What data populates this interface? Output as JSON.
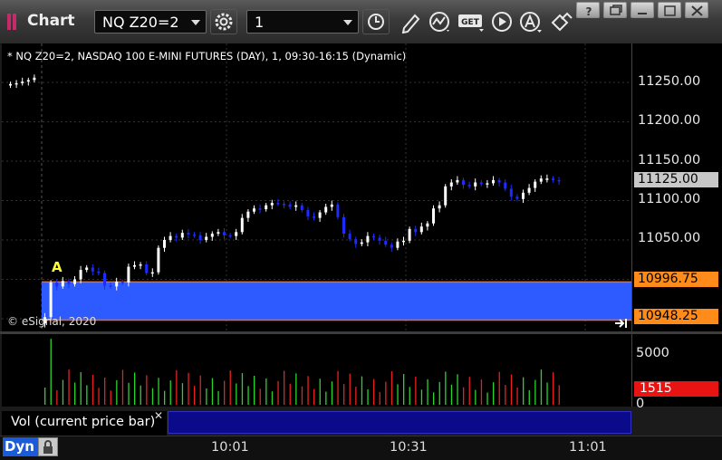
{
  "app": {
    "title": "Chart"
  },
  "toolbar": {
    "symbol_value": "NQ Z20=2",
    "interval_value": "1",
    "icons": [
      "settings-gear-icon",
      "clock-icon",
      "pencil-draw-icon",
      "study-wave-icon",
      "get-icon",
      "play-icon",
      "cursor-a-icon",
      "link-icon"
    ],
    "get_label": "GET"
  },
  "window": {
    "buttons": [
      "help-icon",
      "restore-icon",
      "maximize-icon",
      "close-icon"
    ],
    "help_label": "?"
  },
  "chart": {
    "header": "* NQ Z20=2, NASDAQ 100 E-MINI FUTURES (DAY), 1, 09:30-16:15 (Dynamic)",
    "copyright": "© eSignal, 2020",
    "price_axis_labels": [
      "11250.00",
      "11200.00",
      "11150.00",
      "11100.00",
      "11050.00"
    ],
    "last_price": "11125.00",
    "upper_level": "10996.75",
    "lower_level": "10948.25",
    "marker": "A",
    "colors": {
      "up": "#ffffff",
      "down": "#1d2bff",
      "range_fill": "#2d5bff",
      "range_line": "#ff6a00",
      "tag": "#ff8c1a"
    }
  },
  "chart_data": {
    "type": "candlestick",
    "title": "NQ Z20=2, NASDAQ 100 E-MINI FUTURES (DAY), 1, 09:30-16:15 (Dynamic)",
    "ylim": [
      10940,
      11280
    ],
    "x_ticks": [
      "10:01",
      "10:31",
      "11:01"
    ],
    "closes": [
      11248,
      11249,
      11251,
      11253,
      11256,
      10952,
      10996,
      10991,
      10998,
      10994,
      11000,
      11012,
      11015,
      11010,
      11008,
      10992,
      10991,
      10997,
      10996,
      11016,
      11018,
      11019,
      11008,
      11009,
      11040,
      11050,
      11055,
      11053,
      11059,
      11057,
      11056,
      11050,
      11054,
      11058,
      11060,
      11056,
      11055,
      11060,
      11078,
      11086,
      11090,
      11089,
      11094,
      11097,
      11096,
      11095,
      11092,
      11094,
      11088,
      11080,
      11078,
      11085,
      11092,
      11095,
      11079,
      11058,
      11051,
      11045,
      11047,
      11055,
      11053,
      11049,
      11044,
      11040,
      11048,
      11049,
      11064,
      11060,
      11067,
      11071,
      11090,
      11094,
      11118,
      11123,
      11126,
      11120,
      11118,
      11123,
      11121,
      11122,
      11126,
      11123,
      11115,
      11105,
      11102,
      11110,
      11116,
      11124,
      11128,
      11128,
      11126,
      11125
    ],
    "volume": {
      "label": "Vol (current price bar)",
      "axis": [
        "5000",
        "0"
      ],
      "current": "1515"
    }
  },
  "time_axis": {
    "mode": "Dyn",
    "labels": [
      "10:01",
      "10:31",
      "11:01"
    ]
  }
}
